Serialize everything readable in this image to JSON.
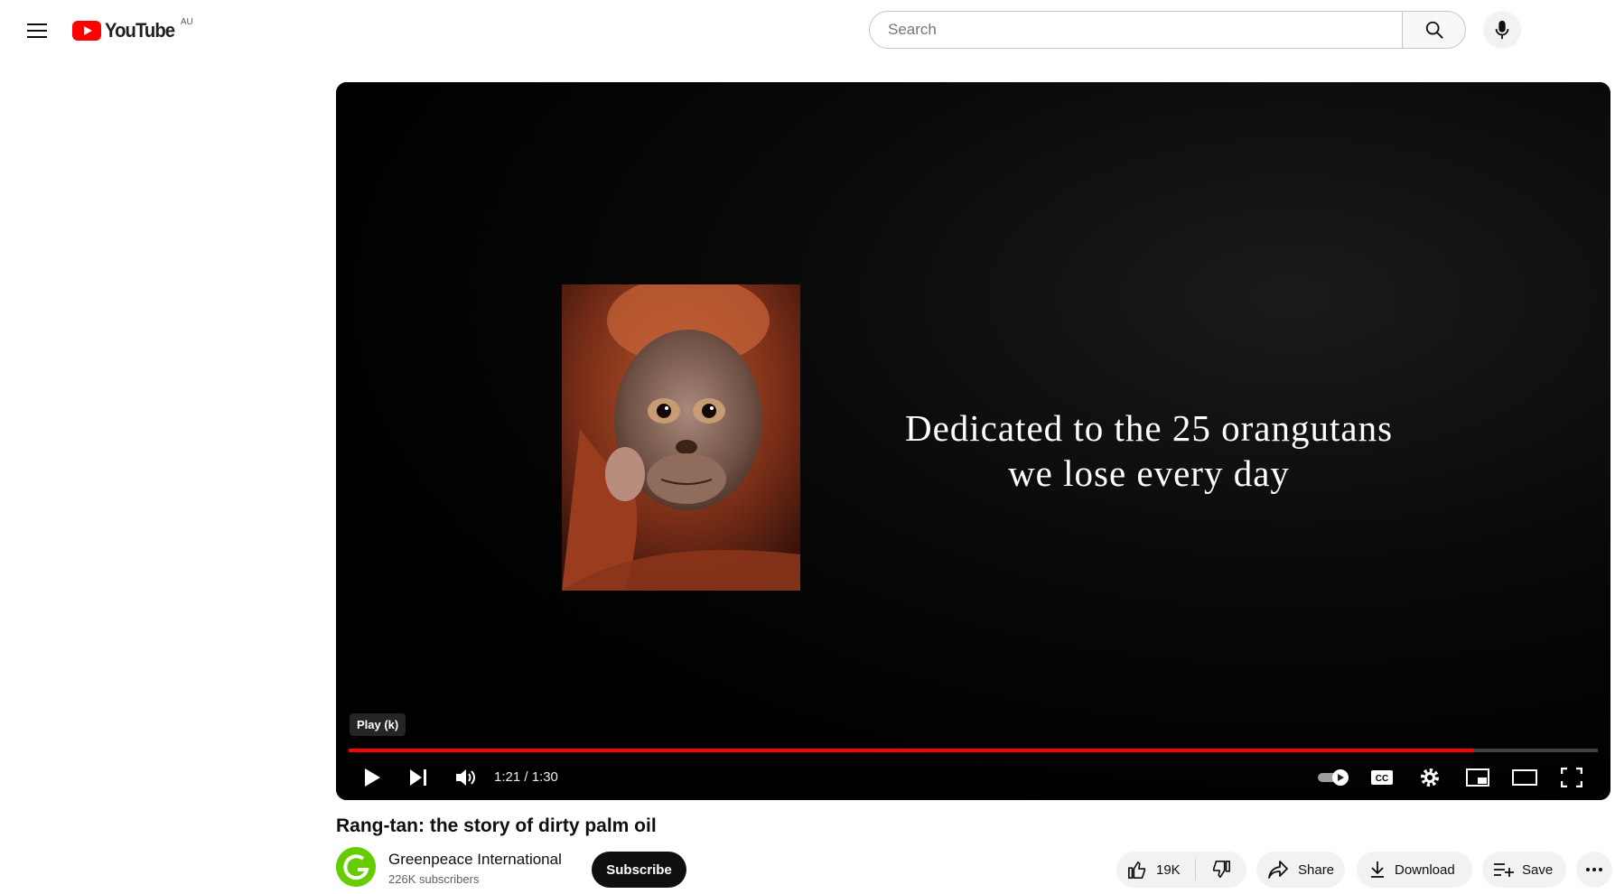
{
  "masthead": {
    "logo_text": "YouTube",
    "region": "AU",
    "search_placeholder": "Search"
  },
  "player": {
    "caption_line1": "Dedicated to the 25 orangutans",
    "caption_line2": "we lose every day",
    "tooltip": "Play (k)",
    "time": "1:21 / 1:30",
    "progress_fraction": 0.9,
    "accent_color": "#ff0000"
  },
  "video": {
    "title": "Rang-tan: the story of dirty palm oil",
    "channel_name": "Greenpeace International",
    "subscribers": "226K subscribers",
    "subscribe_label": "Subscribe",
    "likes": "19K",
    "share_label": "Share",
    "download_label": "Download",
    "save_label": "Save"
  },
  "icons": [
    "menu-icon",
    "youtube-logo-icon",
    "search-icon",
    "mic-icon",
    "play-icon",
    "next-icon",
    "volume-icon",
    "autoplay-toggle-icon",
    "captions-icon",
    "settings-icon",
    "miniplayer-icon",
    "theater-icon",
    "fullscreen-icon",
    "like-icon",
    "dislike-icon",
    "share-icon",
    "download-icon",
    "save-icon",
    "more-icon"
  ]
}
